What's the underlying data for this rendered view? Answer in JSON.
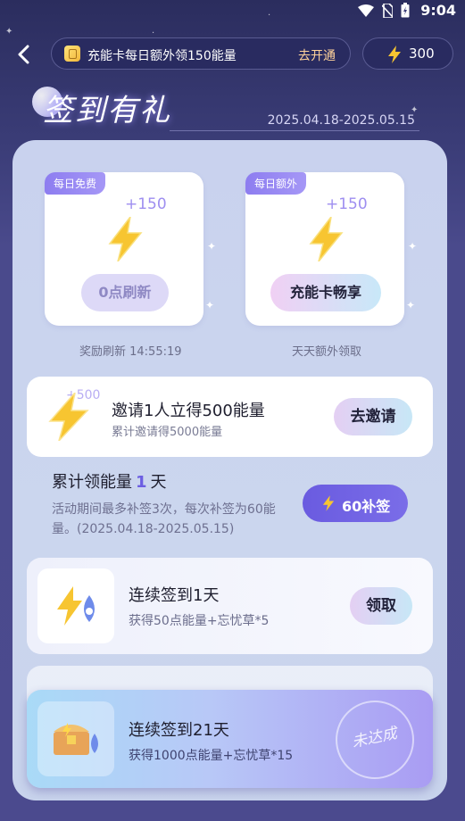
{
  "status_bar": {
    "time": "9:04"
  },
  "header": {
    "promo_text": "充能卡每日额外领150能量",
    "promo_action": "去开通",
    "energy_value": "300"
  },
  "title": {
    "text": "签到有礼",
    "date_range": "2025.04.18-2025.05.15"
  },
  "daily_cards": [
    {
      "tag": "每日免费",
      "amount": "+150",
      "button": "0点刷新",
      "caption": "奖励刷新 14:55:19"
    },
    {
      "tag": "每日额外",
      "amount": "+150",
      "button": "充能卡畅享",
      "caption": "天天额外领取"
    }
  ],
  "invite": {
    "badge": "+500",
    "title": "邀请1人立得500能量",
    "subtitle": "累计邀请得5000能量",
    "button": "去邀请"
  },
  "accumulate": {
    "prefix": "累计领能量",
    "days": "1",
    "suffix": "天",
    "desc": "活动期间最多补签3次，每次补签为60能量。(2025.04.18-2025.05.15)",
    "button": "60补签"
  },
  "tasks": [
    {
      "title": "连续签到1天",
      "subtitle": "获得50点能量+忘忧草*5",
      "button": "领取"
    },
    {
      "title": "连续签到21天",
      "subtitle": "获得1000点能量+忘忧草*15",
      "stamp": "未达成"
    }
  ],
  "colors": {
    "accent": "#6a5be0",
    "bolt": "#f7c531",
    "bg": "#3b3d78"
  }
}
